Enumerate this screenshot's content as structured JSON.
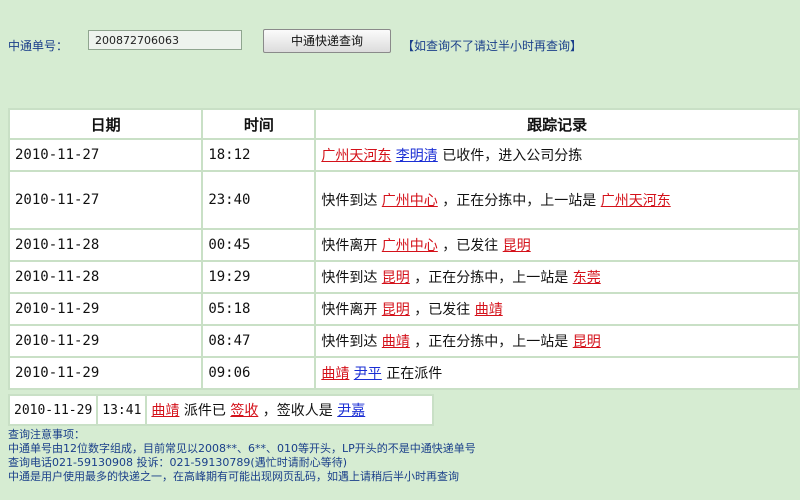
{
  "query": {
    "label": "中通单号：",
    "tracking_number": "200872706063",
    "button_label": "中通快递查询",
    "tip": "【如查询不了请过半小时再查询】"
  },
  "table": {
    "headers": [
      "日期",
      "时间",
      "跟踪记录"
    ],
    "rows": [
      {
        "date": "2010-11-27",
        "time": "18:12",
        "parts": [
          {
            "t": "广州天河东",
            "link": "red"
          },
          {
            "t": " "
          },
          {
            "t": "李明清",
            "link": "blue"
          },
          {
            "t": " 已收件，进入公司分拣"
          }
        ]
      },
      {
        "date": "2010-11-27",
        "time": "23:40",
        "parts": [
          {
            "t": "快件到达 "
          },
          {
            "t": "广州中心",
            "link": "red"
          },
          {
            "t": " ，正在分拣中，上一站是 "
          },
          {
            "t": "广州天河东",
            "link": "red"
          }
        ]
      },
      {
        "date": "2010-11-28",
        "time": "00:45",
        "parts": [
          {
            "t": "快件离开 "
          },
          {
            "t": "广州中心",
            "link": "red"
          },
          {
            "t": " ，已发往 "
          },
          {
            "t": "昆明",
            "link": "red"
          }
        ]
      },
      {
        "date": "2010-11-28",
        "time": "19:29",
        "parts": [
          {
            "t": "快件到达 "
          },
          {
            "t": "昆明",
            "link": "red"
          },
          {
            "t": " ，正在分拣中，上一站是 "
          },
          {
            "t": "东莞",
            "link": "red"
          }
        ]
      },
      {
        "date": "2010-11-29",
        "time": "05:18",
        "parts": [
          {
            "t": "快件离开 "
          },
          {
            "t": "昆明",
            "link": "red"
          },
          {
            "t": " ，已发往 "
          },
          {
            "t": "曲靖",
            "link": "red"
          }
        ]
      },
      {
        "date": "2010-11-29",
        "time": "08:47",
        "parts": [
          {
            "t": "快件到达 "
          },
          {
            "t": "曲靖",
            "link": "red"
          },
          {
            "t": " ，正在分拣中，上一站是 "
          },
          {
            "t": "昆明",
            "link": "red"
          }
        ]
      },
      {
        "date": "2010-11-29",
        "time": "09:06",
        "parts": [
          {
            "t": "曲靖",
            "link": "red"
          },
          {
            "t": " "
          },
          {
            "t": "尹平",
            "link": "blue"
          },
          {
            "t": " 正在派件"
          }
        ]
      }
    ],
    "last_row": {
      "date": "2010-11-29",
      "time": "13:41",
      "parts": [
        {
          "t": "曲靖",
          "link": "red"
        },
        {
          "t": " 派件已 "
        },
        {
          "t": "签收",
          "link": "red"
        },
        {
          "t": " ，签收人是 "
        },
        {
          "t": "尹嘉",
          "link": "blue"
        }
      ]
    }
  },
  "notes": [
    "查询注意事项：",
    "中通单号由12位数字组成，目前常见以2008**、6**、010等开头，LP开头的不是中通快递单号",
    "查询电话021-59130908 投诉：021-59130789(遇忙时请耐心等待)",
    "中通是用户使用最多的快递之一，在高峰期有可能出现网页乱码，如遇上请稍后半小时再查询"
  ],
  "colors": {
    "background": "#d6ecd2",
    "link_red": "#d4111a",
    "link_blue": "#1b2fd4",
    "note_text": "#1a3f8a"
  }
}
